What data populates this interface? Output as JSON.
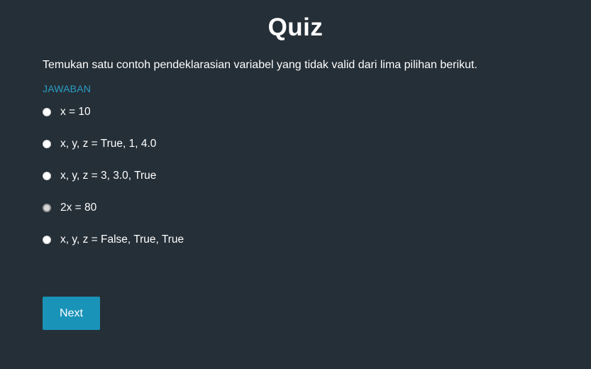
{
  "quiz": {
    "title": "Quiz",
    "question": "Temukan satu contoh pendeklarasian variabel yang tidak valid dari lima pilihan berikut.",
    "answer_label": "JAWABAN",
    "options": [
      {
        "label": "x = 10"
      },
      {
        "label": "x, y, z = True, 1, 4.0"
      },
      {
        "label": "x, y, z = 3, 3.0, True"
      },
      {
        "label": "2x = 80"
      },
      {
        "label": "x, y, z = False, True, True"
      }
    ],
    "next_label": "Next"
  },
  "colors": {
    "background": "#252f37",
    "accent": "#1a93b9",
    "answer_label": "#2a9ec4",
    "text": "#ffffff"
  }
}
